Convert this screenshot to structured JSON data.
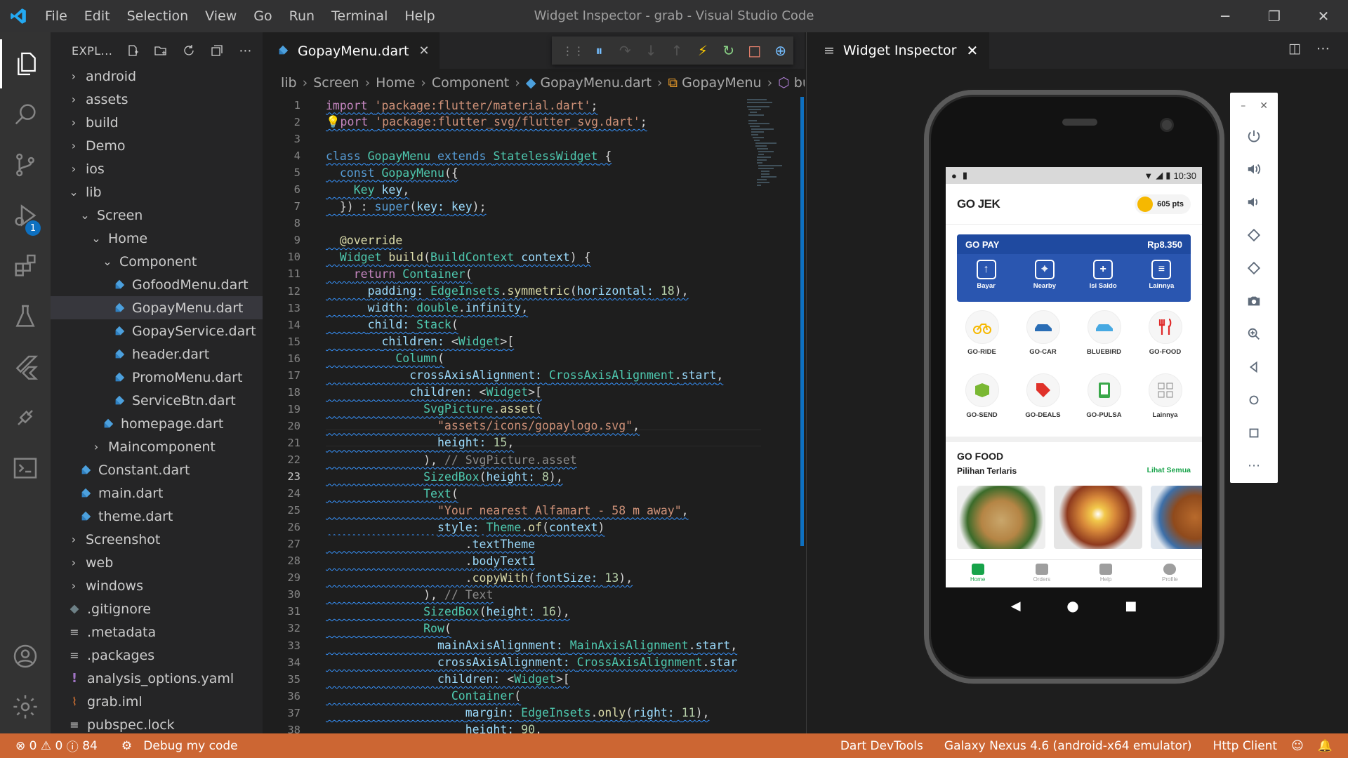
{
  "window": {
    "title": "Widget Inspector - grab - Visual Studio Code",
    "menu": [
      "File",
      "Edit",
      "Selection",
      "View",
      "Go",
      "Run",
      "Terminal",
      "Help"
    ]
  },
  "activity_bar": {
    "icons": [
      "explorer-icon",
      "search-icon",
      "source-control-icon",
      "run-debug-icon",
      "extensions-icon",
      "testing-icon",
      "flutter-icon",
      "remote-icon",
      "terminal-icon",
      "account-icon",
      "settings-gear-icon"
    ],
    "debug_badge": "1"
  },
  "sidebar": {
    "title": "EXPL...",
    "tree": [
      {
        "label": "android",
        "indent": 1,
        "kind": "folder",
        "open": false
      },
      {
        "label": "assets",
        "indent": 1,
        "kind": "folder",
        "open": false
      },
      {
        "label": "build",
        "indent": 1,
        "kind": "folder",
        "open": false
      },
      {
        "label": "Demo",
        "indent": 1,
        "kind": "folder",
        "open": false
      },
      {
        "label": "ios",
        "indent": 1,
        "kind": "folder",
        "open": false
      },
      {
        "label": "lib",
        "indent": 1,
        "kind": "folder",
        "open": true
      },
      {
        "label": "Screen",
        "indent": 2,
        "kind": "folder",
        "open": true
      },
      {
        "label": "Home",
        "indent": 3,
        "kind": "folder",
        "open": true
      },
      {
        "label": "Component",
        "indent": 4,
        "kind": "folder",
        "open": true
      },
      {
        "label": "GofoodMenu.dart",
        "indent": 5,
        "kind": "dart"
      },
      {
        "label": "GopayMenu.dart",
        "indent": 5,
        "kind": "dart",
        "selected": true
      },
      {
        "label": "GopayService.dart",
        "indent": 5,
        "kind": "dart"
      },
      {
        "label": "header.dart",
        "indent": 5,
        "kind": "dart"
      },
      {
        "label": "PromoMenu.dart",
        "indent": 5,
        "kind": "dart"
      },
      {
        "label": "ServiceBtn.dart",
        "indent": 5,
        "kind": "dart"
      },
      {
        "label": "homepage.dart",
        "indent": 4,
        "kind": "dart"
      },
      {
        "label": "Maincomponent",
        "indent": 3,
        "kind": "folder",
        "open": false
      },
      {
        "label": "Constant.dart",
        "indent": 2,
        "kind": "dart"
      },
      {
        "label": "main.dart",
        "indent": 2,
        "kind": "dart"
      },
      {
        "label": "theme.dart",
        "indent": 2,
        "kind": "dart"
      },
      {
        "label": "Screenshot",
        "indent": 1,
        "kind": "folder",
        "open": false
      },
      {
        "label": "web",
        "indent": 1,
        "kind": "folder",
        "open": false
      },
      {
        "label": "windows",
        "indent": 1,
        "kind": "folder",
        "open": false
      },
      {
        "label": ".gitignore",
        "indent": 1,
        "kind": "git"
      },
      {
        "label": ".metadata",
        "indent": 1,
        "kind": "lines"
      },
      {
        "label": ".packages",
        "indent": 1,
        "kind": "lines"
      },
      {
        "label": "analysis_options.yaml",
        "indent": 1,
        "kind": "yaml"
      },
      {
        "label": "grab.iml",
        "indent": 1,
        "kind": "rss"
      },
      {
        "label": "pubspec.lock",
        "indent": 1,
        "kind": "lines"
      }
    ]
  },
  "editor": {
    "tab": "GopayMenu.dart",
    "breadcrumb": [
      "lib",
      "Screen",
      "Home",
      "Component",
      "GopayMenu.dart",
      "GopayMenu",
      "bu"
    ],
    "current_line": 23,
    "lines": [
      {
        "n": "1",
        "html": "<span class=\"kc\">import</span> <span class=\"st\">'package:flutter/material.dart'</span>;"
      },
      {
        "n": "2",
        "html": "<span class=\"fn\">💡</span><span class=\"kc\">port</span> <span class=\"st\">'package:flutter_svg/flutter_svg.dart'</span>;"
      },
      {
        "n": "3",
        "html": " "
      },
      {
        "n": "4",
        "html": "<span class=\"kw\">class</span> <span class=\"ty\">GopayMenu</span> <span class=\"kw\">extends</span> <span class=\"ty\">StatelessWidget</span> {"
      },
      {
        "n": "5",
        "html": "  <span class=\"kw\">const</span> <span class=\"ty\">GopayMenu</span>({"
      },
      {
        "n": "6",
        "html": "    <span class=\"ty\">Key</span> <span class=\"pr\">key</span>,"
      },
      {
        "n": "7",
        "html": "  }) : <span class=\"kw\">super</span>(<span class=\"pr\">key:</span> <span class=\"pr\">key</span>);"
      },
      {
        "n": "8",
        "html": " "
      },
      {
        "n": "9",
        "html": "  <span class=\"fn\">@override</span>"
      },
      {
        "n": "10",
        "html": "  <span class=\"ty\">Widget</span> <span class=\"fn\">build</span>(<span class=\"ty\">BuildContext</span> <span class=\"pr\">context</span>) {"
      },
      {
        "n": "11",
        "html": "    <span class=\"kc\">return</span> <span class=\"ty\">Container</span>("
      },
      {
        "n": "12",
        "html": "      <span class=\"pr\">padding:</span> <span class=\"ty\">EdgeInsets</span>.<span class=\"fn\">symmetric</span>(<span class=\"pr\">horizontal:</span> <span class=\"nu\">18</span>),"
      },
      {
        "n": "13",
        "html": "      <span class=\"pr\">width:</span> <span class=\"ty\">double</span>.<span class=\"pr\">infinity</span>,"
      },
      {
        "n": "14",
        "html": "      <span class=\"pr\">child:</span> <span class=\"ty\">Stack</span>("
      },
      {
        "n": "15",
        "html": "        <span class=\"pr\">children:</span> &lt;<span class=\"ty\">Widget</span>&gt;["
      },
      {
        "n": "16",
        "html": "          <span class=\"ty\">Column</span>("
      },
      {
        "n": "17",
        "html": "            <span class=\"pr\">crossAxisAlignment:</span> <span class=\"ty\">CrossAxisAlignment</span>.<span class=\"pr\">start</span>,"
      },
      {
        "n": "18",
        "html": "            <span class=\"pr\">children:</span> &lt;<span class=\"ty\">Widget</span>&gt;["
      },
      {
        "n": "19",
        "html": "              <span class=\"ty\">SvgPicture</span>.<span class=\"fn\">asset</span>("
      },
      {
        "n": "20",
        "html": "                <span class=\"st\">\"assets/icons/gopaylogo.svg\"</span>,"
      },
      {
        "n": "21",
        "html": "                <span class=\"pr\">height:</span> <span class=\"nu\">15</span>,"
      },
      {
        "n": "22",
        "html": "              ), <span class=\"cmg\">// SvgPicture.asset</span>"
      },
      {
        "n": "23",
        "html": "              <span class=\"ty\">SizedBox</span>(<span class=\"pr\">height:</span> <span class=\"nu\">8</span>),"
      },
      {
        "n": "24",
        "html": "              <span class=\"ty\">Text</span>("
      },
      {
        "n": "25",
        "html": "                <span class=\"st\">\"Your nearest Alfamart - 58 m away\"</span>,"
      },
      {
        "n": "26",
        "html": "                <span class=\"pr\">style:</span> <span class=\"ty\">Theme</span>.<span class=\"fn\">of</span>(<span class=\"pr\">context</span>)"
      },
      {
        "n": "27",
        "html": "                    .<span class=\"pr\">textTheme</span>"
      },
      {
        "n": "28",
        "html": "                    .<span class=\"pr\">bodyText1</span>"
      },
      {
        "n": "29",
        "html": "                    .<span class=\"fn\">copyWith</span>(<span class=\"pr\">fontSize:</span> <span class=\"nu\">13</span>),"
      },
      {
        "n": "30",
        "html": "              ), <span class=\"cmg\">// Text</span>"
      },
      {
        "n": "31",
        "html": "              <span class=\"ty\">SizedBox</span>(<span class=\"pr\">height:</span> <span class=\"nu\">16</span>),"
      },
      {
        "n": "32",
        "html": "              <span class=\"ty\">Row</span>("
      },
      {
        "n": "33",
        "html": "                <span class=\"pr\">mainAxisAlignment:</span> <span class=\"ty\">MainAxisAlignment</span>.<span class=\"pr\">start</span>,"
      },
      {
        "n": "34",
        "html": "                <span class=\"pr\">crossAxisAlignment:</span> <span class=\"ty\">CrossAxisAlignment</span>.<span class=\"pr\">star</span>"
      },
      {
        "n": "35",
        "html": "                <span class=\"pr\">children:</span> &lt;<span class=\"ty\">Widget</span>&gt;["
      },
      {
        "n": "36",
        "html": "                  <span class=\"ty\">Container</span>("
      },
      {
        "n": "37",
        "html": "                    <span class=\"pr\">margin:</span> <span class=\"ty\">EdgeInsets</span>.<span class=\"fn\">only</span>(<span class=\"pr\">right:</span> <span class=\"nu\">11</span>),"
      },
      {
        "n": "38",
        "html": "                    <span class=\"pr\">height:</span> <span class=\"nu\">90</span>,"
      }
    ]
  },
  "inspector": {
    "tab": "Widget Inspector",
    "phone": {
      "status_time": "10:30",
      "brand": "GO JEK",
      "points": "605 pts",
      "gopay_label": "GO PAY",
      "balance": "Rp8.350",
      "gopay_items": [
        "Bayar",
        "Nearby",
        "Isi Saldo",
        "Lainnya"
      ],
      "services": [
        "GO-RIDE",
        "GO-CAR",
        "BLUEBIRD",
        "GO-FOOD",
        "GO-SEND",
        "GO-DEALS",
        "GO-PULSA",
        "Lainnya"
      ],
      "gofood_title": "GO FOOD",
      "gofood_subtitle": "Pilihan Terlaris",
      "see_all": "Lihat Semua",
      "nav": [
        "Home",
        "Orders",
        "Help",
        "Profile"
      ]
    }
  },
  "status": {
    "errors": "0",
    "warnings": "0",
    "info": "84",
    "debug": "Debug my code",
    "devtools": "Dart DevTools",
    "device": "Galaxy Nexus 4.6 (android-x64 emulator)",
    "http": "Http Client"
  },
  "colors": {
    "accent": "#0e70c0",
    "statusbar": "#cc6633",
    "gopay": "#2a56b0",
    "gojek_green": "#17a34a"
  }
}
